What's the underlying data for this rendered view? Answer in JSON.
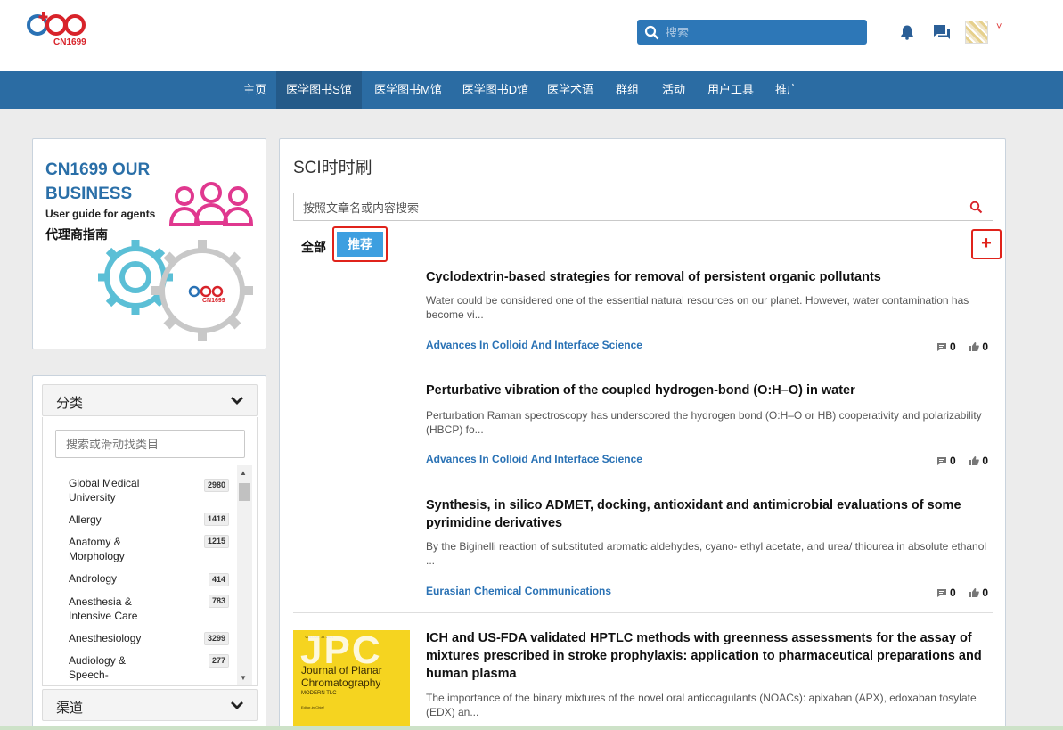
{
  "header": {
    "logo_text": "CN1699",
    "search_placeholder": "搜索"
  },
  "nav": {
    "items": [
      {
        "label": "主页"
      },
      {
        "label": "医学图书S馆"
      },
      {
        "label": "医学图书M馆"
      },
      {
        "label": "医学图书D馆"
      },
      {
        "label": "医学术语"
      },
      {
        "label": "群组"
      },
      {
        "label": "活动"
      },
      {
        "label": "用户工具"
      },
      {
        "label": "推广"
      }
    ],
    "active_index": 1
  },
  "ad": {
    "line1": "CN1699 OUR",
    "line2": "BUSINESS",
    "line3": "User guide for agents",
    "line4": "代理商指南",
    "logo": "CN1699"
  },
  "sidebar": {
    "category_title": "分类",
    "category_search_placeholder": "搜索或滑动找类目",
    "categories": [
      {
        "name": "Global Medical University",
        "count": "2980"
      },
      {
        "name": "Allergy",
        "count": "1418"
      },
      {
        "name": "Anatomy & Morphology",
        "count": "1215"
      },
      {
        "name": "Andrology",
        "count": "414"
      },
      {
        "name": "Anesthesia & Intensive Care",
        "count": "783"
      },
      {
        "name": "Anesthesiology",
        "count": "3299"
      },
      {
        "name": "Audiology & Speech-",
        "count": "277"
      }
    ],
    "channel_title": "渠道"
  },
  "main": {
    "title": "SCI时时刷",
    "search_placeholder": "按照文章名或内容搜索",
    "tab_all": "全部",
    "tab_recommend": "推荐",
    "add_label": "+",
    "articles": [
      {
        "title": "Cyclodextrin-based strategies for removal of persistent organic pollutants",
        "abstract": "Water could be considered one of the essential natural resources on our planet. However, water contamination has become vi...",
        "source": "Advances In Colloid And Interface Science",
        "comments": "0",
        "likes": "0"
      },
      {
        "title": "Perturbative vibration of the coupled hydrogen-bond (O:H–O) in water",
        "abstract": "Perturbation Raman spectroscopy has underscored the hydrogen bond (O:H–O or HB) cooperativity and polarizability (HBCP) fo...",
        "source": "Advances In Colloid And Interface Science",
        "comments": "0",
        "likes": "0"
      },
      {
        "title": "Synthesis, in silico ADMET, docking, antioxidant and antimicrobial evaluations of some pyrimidine derivatives",
        "abstract": "By the Biginelli reaction of substituted aromatic aldehydes, cyano- ethyl acetate, and urea/ thiourea in absolute ethanol ...",
        "source": "Eurasian Chemical Communications",
        "comments": "0",
        "likes": "0"
      },
      {
        "title": "ICH and US-FDA validated HPTLC methods with greenness assessments for the assay of mixtures prescribed in stroke prophylaxis: application to pharmaceutical preparations and human plasma",
        "abstract": "The importance of the binary mixtures of the novel oral anticoagulants (NOACs): apixaban (APX), edoxaban tosylate (EDX) an...",
        "cover": {
          "top_text": "VOLUME 34 2021",
          "big": "JPC",
          "title": "Journal of Planar Chromatography",
          "subtitle": "MODERN TLC",
          "bottom_text": "Editor-in-Chief"
        }
      }
    ]
  },
  "colors": {
    "nav_bg": "#2b6ca3",
    "nav_active": "#245a89",
    "link": "#2a72b5",
    "highlight": "#e0231b",
    "tab_active": "#3d9fe0"
  }
}
